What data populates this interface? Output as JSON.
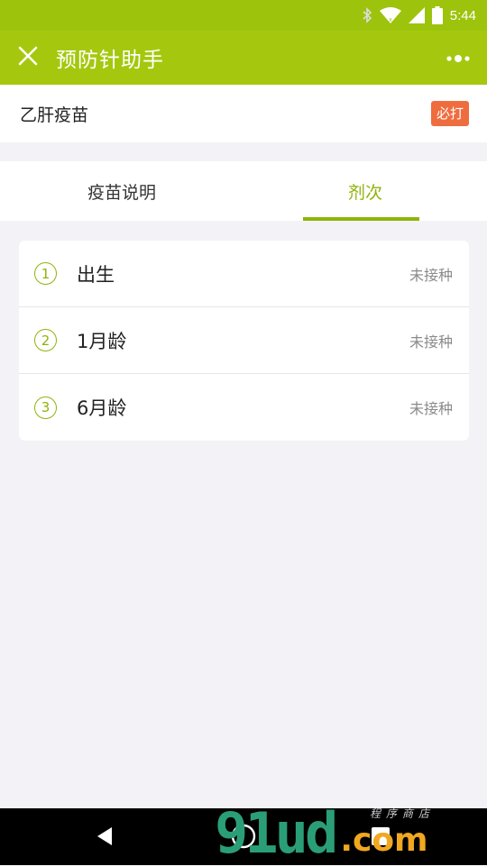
{
  "status_bar": {
    "time": "5:44",
    "icons": [
      "bluetooth-icon",
      "wifi-icon",
      "signal-icon",
      "battery-icon"
    ]
  },
  "header": {
    "title": "预防针助手",
    "close_icon": "close-icon",
    "more_icon": "more-dots-icon"
  },
  "vaccine": {
    "name": "乙肝疫苗",
    "badge": "必打"
  },
  "tabs": [
    {
      "label": "疫苗说明",
      "active": false
    },
    {
      "label": "剂次",
      "active": true
    }
  ],
  "doses": [
    {
      "number": "1",
      "label": "出生",
      "status": "未接种"
    },
    {
      "number": "2",
      "label": "1月龄",
      "status": "未接种"
    },
    {
      "number": "3",
      "label": "6月龄",
      "status": "未接种"
    }
  ],
  "watermark": {
    "main": "91ud",
    "suffix": ".com",
    "small": "程序商店"
  },
  "colors": {
    "accent": "#a5c80e",
    "badge": "#ef6c3f",
    "tab_active": "#8fb30a",
    "background": "#f3f3f7"
  }
}
